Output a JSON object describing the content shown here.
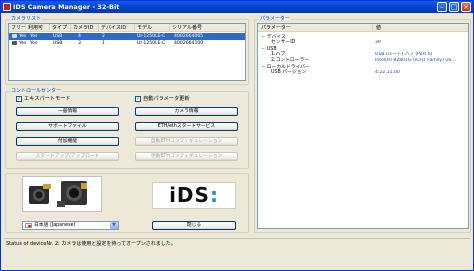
{
  "window": {
    "title": "IDS Camera Manager - 32-Bit",
    "colors": {
      "titlebar": "#0842c9",
      "selection": "#316ac5",
      "group_label": "#0046d5"
    }
  },
  "camera_list": {
    "label": "カメラリスト",
    "columns": [
      "フリー",
      "利用可",
      "タイプ",
      "カメラID",
      "デバイスID",
      "モデル",
      "シリアル番号"
    ],
    "rows": [
      {
        "icon": "camera-icon",
        "free": "Yes",
        "available": "Yes",
        "type": "USB",
        "camera_id": "4",
        "device_id": "2",
        "model": "UI-1250LE-C",
        "serial": "4002664065",
        "selected": true
      },
      {
        "icon": "camera-icon",
        "free": "Yes",
        "available": "Yes",
        "type": "USB",
        "camera_id": "3",
        "device_id": "1",
        "model": "UI-1250LE-C",
        "serial": "4002664100",
        "selected": false
      }
    ]
  },
  "control_center": {
    "label": "コントロールセンター",
    "expert_mode_label": "エキスパートモード",
    "expert_mode_checked": true,
    "auto_param_label": "自動パラメータ更新",
    "auto_param_checked": true,
    "buttons": {
      "general_info": "一般情報",
      "camera_info": "カメラ情報",
      "support_file": "サポートファイル",
      "eth_service": "ETH/ethスタートサービス",
      "extra_features": "付加機能",
      "auto_eth_config": "自動ETHコンフィギュレーション",
      "startup_upload": "スタートアップ/アップロード",
      "manual_eth_config": "手動ETHコンフィギュレーション"
    }
  },
  "language": {
    "selected": "日本語 (Japanese)"
  },
  "close_button": "閉じる",
  "properties": {
    "label": "パラメーター",
    "col_name": "パラメーター",
    "col_value": "値",
    "rows": [
      {
        "name": "デバイス",
        "value": "",
        "indent": 0,
        "toggle": "−"
      },
      {
        "name": "センサーID",
        "value": "39",
        "indent": 2,
        "toggle": ""
      },
      {
        "name": "USB",
        "value": "",
        "indent": 0,
        "toggle": "−"
      },
      {
        "name": "1.ハブ",
        "value": "USB (ルート) ハブ (Port 6)",
        "indent": 2,
        "toggle": ""
      },
      {
        "name": "2.コントローラー",
        "value": "Intel(R) 82801G (ICH7 Family) US...",
        "indent": 2,
        "toggle": ""
      },
      {
        "name": "ローカルドライバー",
        "value": "",
        "indent": 0,
        "toggle": "−"
      },
      {
        "name": "USB バージョン",
        "value": "4.22.11.00",
        "indent": 2,
        "toggle": ""
      }
    ]
  },
  "status_bar": "Status of deviceNr. 2: カメラは使用と設定を待ってオープンされました。"
}
